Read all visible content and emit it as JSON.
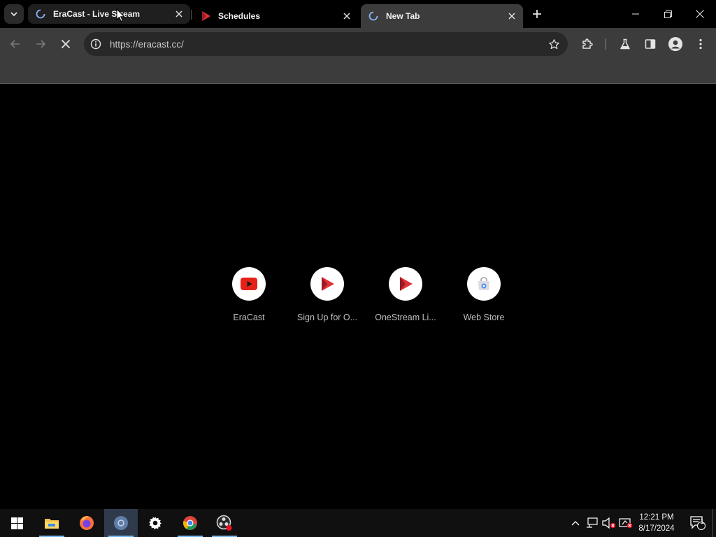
{
  "browser": {
    "tabs": [
      {
        "title": "EraCast - Live Stream",
        "favicon": "loading-spinner-icon"
      },
      {
        "title": "Schedules",
        "favicon": "play-logo-icon"
      },
      {
        "title": "New Tab",
        "favicon": "loading-spinner-icon",
        "active": true
      }
    ],
    "url": "https://eracast.cc/",
    "colors": {
      "tab_active": "#3c3c3c",
      "toolbar": "#3c3c3c",
      "content_bg": "#000000"
    }
  },
  "new_tab_page": {
    "shortcuts": [
      {
        "label": "EraCast",
        "icon": "youtube-icon"
      },
      {
        "label": "Sign Up for O...",
        "icon": "red-play-icon"
      },
      {
        "label": "OneStream Li...",
        "icon": "red-play-icon"
      },
      {
        "label": "Web Store",
        "icon": "web-store-icon"
      }
    ]
  },
  "taskbar": {
    "apps": [
      "start-icon",
      "file-explorer-icon",
      "firefox-icon",
      "chrome-icon",
      "settings-icon",
      "chrome-icon",
      "obs-icon"
    ],
    "clock_time": "12:21 PM",
    "clock_date": "8/17/2024",
    "notification_count": "1"
  }
}
